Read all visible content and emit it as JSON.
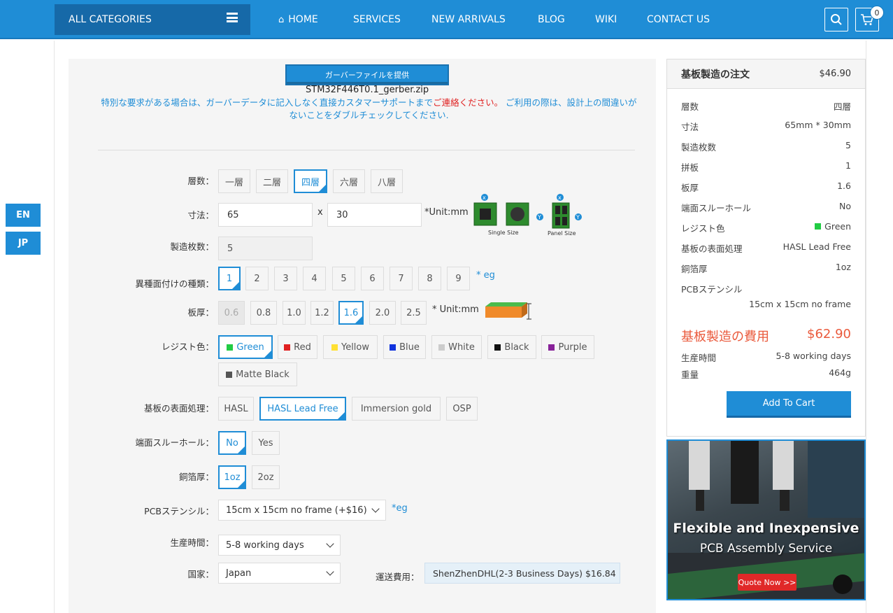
{
  "header": {
    "all_categories": "ALL CATEGORIES",
    "nav": [
      "HOME",
      "SERVICES",
      "NEW ARRIVALS",
      "BLOG",
      "WIKI",
      "CONTACT US"
    ],
    "cart_count": "0"
  },
  "lang": [
    "EN",
    "JP"
  ],
  "upload": {
    "button": "ガーバーファイルを提供",
    "filename": "STM32F446T0.1_gerber.zip",
    "note_1": "特別な要求がある場合は、ガーバーデータに記入しなく直接カスタマーサポートまで",
    "note_link": "ご連絡ください。",
    "note_2": " ご利用の際は、設計上の間違いがないことをダブルチェックしてください."
  },
  "form": {
    "layers_label": "層数：",
    "layers": [
      "一層",
      "二層",
      "四層",
      "六層",
      "八層"
    ],
    "size_label": "寸法：",
    "size_w": "65",
    "size_h": "30",
    "size_x": "x",
    "size_unit": "*Unit:mm",
    "single_size": "Single Size",
    "panel_size": "Panel Size",
    "qty_label": "製造枚数：",
    "qty": "5",
    "diff_label": "異種面付けの種類：",
    "diff": [
      "1",
      "2",
      "3",
      "4",
      "5",
      "6",
      "7",
      "8",
      "9"
    ],
    "diff_eg": "* eg",
    "thick_label": "板厚：",
    "thick": [
      "0.6",
      "0.8",
      "1.0",
      "1.2",
      "1.6",
      "2.0",
      "2.5"
    ],
    "thick_unit": "* Unit:mm",
    "mask_label": "レジスト色：",
    "mask": [
      {
        "name": "Green",
        "color": "#22cc44"
      },
      {
        "name": "Red",
        "color": "#e02020"
      },
      {
        "name": "Yellow",
        "color": "#ffe033"
      },
      {
        "name": "Blue",
        "color": "#1133dd"
      },
      {
        "name": "White",
        "color": "#cccccc"
      },
      {
        "name": "Black",
        "color": "#111111"
      },
      {
        "name": "Purple",
        "color": "#882299"
      },
      {
        "name": "Matte Black",
        "color": "#555555"
      }
    ],
    "finish_label": "基板の表面処理：",
    "finish": [
      "HASL",
      "HASL Lead Free",
      "Immersion gold",
      "OSP"
    ],
    "edge_label": "端面スルーホール：",
    "edge": [
      "No",
      "Yes"
    ],
    "copper_label": "銅箔厚：",
    "copper": [
      "1oz",
      "2oz"
    ],
    "stencil_label": "PCBステンシル：",
    "stencil": "15cm x 15cm no frame (+$16)",
    "stencil_eg": "*eg",
    "lead_label": "生産時間：",
    "lead": "5-8 working days",
    "country_label": "国家：",
    "country": "Japan",
    "ship_label": "運送費用：",
    "ship": "ShenZhenDHL(2-3 Business Days) $16.84"
  },
  "summary": {
    "title": "基板製造の注文",
    "price": "$46.90",
    "rows": [
      {
        "k": "層数",
        "v": "四層"
      },
      {
        "k": "寸法",
        "v": "65mm * 30mm"
      },
      {
        "k": "製造枚数",
        "v": "5"
      },
      {
        "k": "拼板",
        "v": "1"
      },
      {
        "k": "板厚",
        "v": "1.6"
      },
      {
        "k": "端面スルーホール",
        "v": "No"
      },
      {
        "k": "レジスト色",
        "v": "Green"
      },
      {
        "k": "基板の表面処理",
        "v": "HASL Lead Free"
      },
      {
        "k": "銅箔厚",
        "v": "1oz"
      },
      {
        "k": "PCBステンシル",
        "v": ""
      }
    ],
    "stencil_value": "15cm x 15cm no frame",
    "cost_label": "基板製造の費用",
    "cost": "$62.90",
    "lead_label": "生産時間",
    "lead": "5-8 working days",
    "weight_label": "重量",
    "weight": "464g",
    "add_to_cart": "Add To Cart",
    "mask_color": "#22cc44"
  },
  "banner": {
    "line1": "Flexible and Inexpensive",
    "line2": "PCB Assembly Service",
    "cta": "Quote Now >>"
  }
}
